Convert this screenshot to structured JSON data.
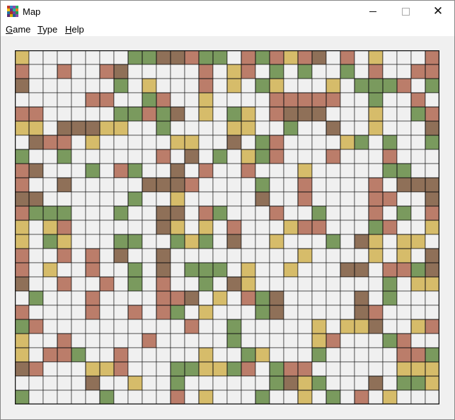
{
  "window": {
    "title": "Map"
  },
  "menu": [
    {
      "name": "menu-game",
      "accel": "G",
      "rest": "ame"
    },
    {
      "name": "menu-type",
      "accel": "T",
      "rest": "ype"
    },
    {
      "name": "menu-help",
      "accel": "H",
      "rest": "elp"
    }
  ],
  "colors": {
    "green": "#7a9a5e",
    "tan": "#d6bc6a",
    "salmon": "#bb7d6a",
    "brown": "#8f7058",
    "empty": "#f0f0f0",
    "line": "#111111"
  },
  "map": {
    "cols": 30,
    "rows": 25,
    "cells": [
      "t.......ggbbsgg.sgstsb.s.t...s",
      "s..s..sb.....s.ts.g.g..g.s..ss",
      "b......g.t...s.t.gt...t.gggs.g",
      ".....ss..gs..t....sssss..g..s.",
      "ss.....ggsgb.t.gt.sbbb...t..gs",
      "tt.bbbtt..g....tt..g..b..t...b",
      ".bss.t.....tt..b.gs....tg.g..g",
      "g..g......s.b.g.tgs...s...s...",
      "sb...g.sg..b.s..s...t.....gg..",
      "s..b.....bbbs....g..s....s.bbb",
      "bb......g..t.....b..s....ss..b",
      "sggg...g..bb.sg...s..g...s.g.s",
      "t.ts......bt.t.s...tss...gs..t",
      "t.gt...gg..gtg.b..t...g.bt.tt.",
      "s..s.s.b..b.........t....t.t.b",
      "s.t..s..g.b.ggg.t..t...bb.ssgb",
      "b..s..s.g.s..g.bt.........g.tt",
      ".g...s....ssb.t.sgb.....b.g....",
      "s....s..s.sg.t...gb.....bs....s",
      "gs..........s..g.....t.ttb..ts",
      "t..s.....s.....g.....ts...gs..s",
      "t.ssg..s.....t..gt...g.....ssg",
      "bs...tts...ggttgs.gss......ttt",
      ".....b..t..g......gbtg...b.ggt",
      "g.....g....s.t...g..t.g.s.t...",
      "s..s...t..tg.....s..g..s.ggtg",
      "ss..bbg...g....ss.bs.bg....ss.",
      "..bs.b.gggsbgg...bg.gtb.....t.",
      "...........ggsg.....s......gggg"
    ],
    "walls": [
      "..xx..x..xx..x..xx..x..xx..x..",
      ".x..x..x..x..x..x..x..x..x..x.",
      "x..x..x..x..x..x..x..x..x..x..",
      "..x..x..x..x..x..x..x..x..x..x",
      ".x..x..x..x..x..x..x..x..x..x."
    ]
  }
}
